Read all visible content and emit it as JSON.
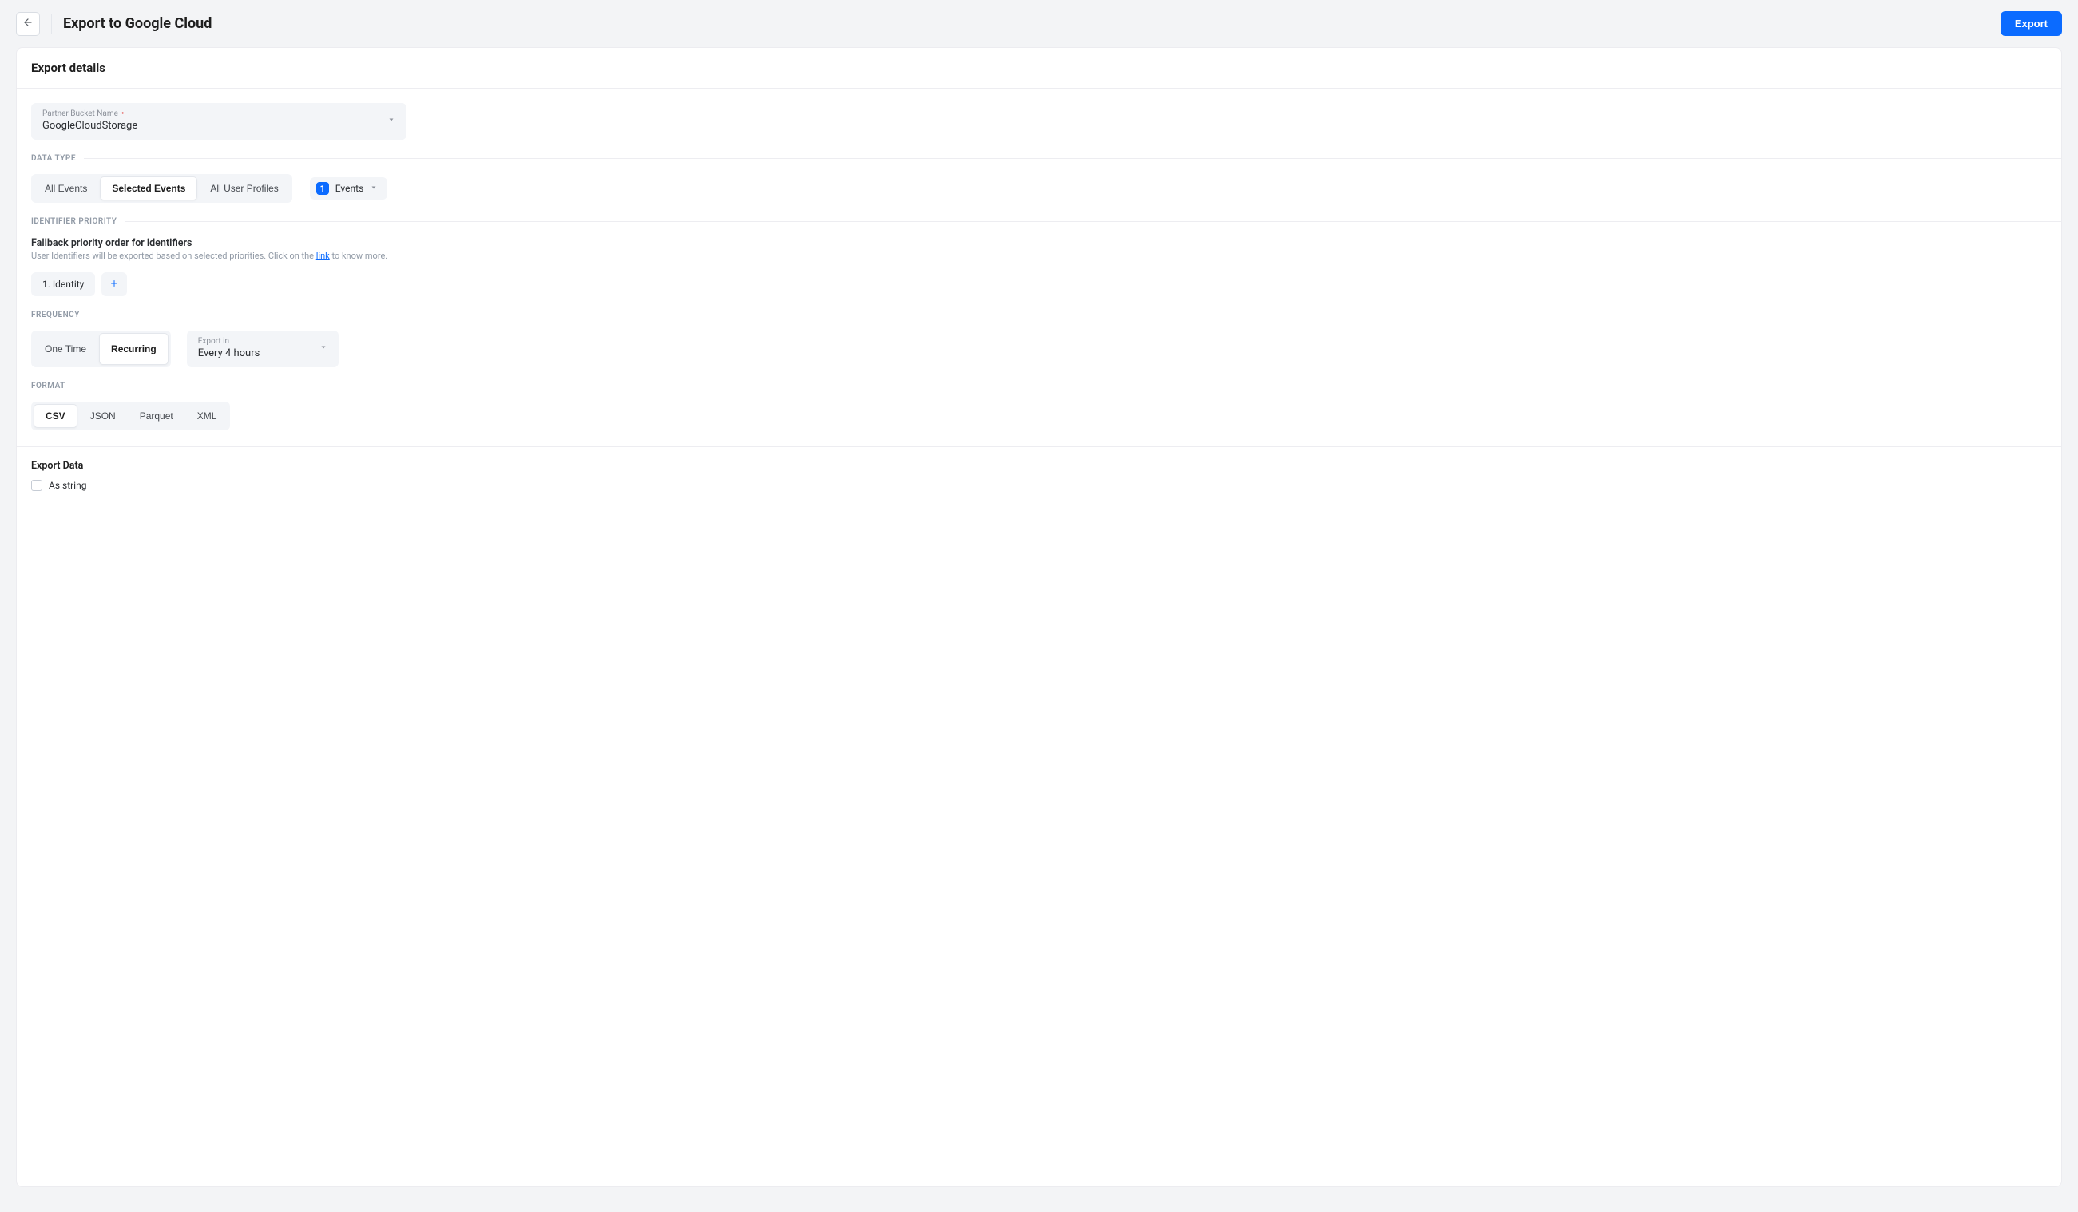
{
  "header": {
    "title": "Export to Google Cloud",
    "export_button": "Export"
  },
  "card": {
    "title": "Export details"
  },
  "bucket": {
    "label": "Partner Bucket Name",
    "value": "GoogleCloudStorage"
  },
  "data_type": {
    "divider_label": "DATA TYPE",
    "options": [
      "All Events",
      "Selected Events",
      "All User Profiles"
    ],
    "selected": "Selected Events",
    "events_chip": {
      "count": "1",
      "label": "Events"
    }
  },
  "identifier": {
    "divider_label": "IDENTIFIER PRIORITY",
    "heading": "Fallback priority order for identifiers",
    "sub_pre": "User Identifiers will be exported based on selected priorities. Click on the ",
    "sub_link": "link",
    "sub_post": " to know more.",
    "items": [
      "1. Identity"
    ]
  },
  "frequency": {
    "divider_label": "FREQUENCY",
    "options": [
      "One Time",
      "Recurring"
    ],
    "selected": "Recurring",
    "export_in_label": "Export in",
    "export_in_value": "Every 4 hours"
  },
  "format": {
    "divider_label": "FORMAT",
    "options": [
      "CSV",
      "JSON",
      "Parquet",
      "XML"
    ],
    "selected": "CSV"
  },
  "export_data": {
    "heading": "Export Data",
    "as_string": "As string",
    "as_string_checked": false
  }
}
